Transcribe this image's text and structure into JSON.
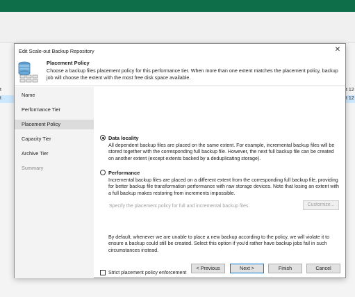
{
  "background": {
    "left_row1": "t",
    "left_row2": "t",
    "right_row1": "t 12",
    "right_row2": "t 12"
  },
  "dialog": {
    "title": "Edit Scale-out Backup Repository",
    "close_glyph": "✕"
  },
  "header": {
    "title": "Placement Policy",
    "description": "Choose a backup files placement policy for this performance tier. When more than one extent matches the placement policy, backup job will choose the extent with the most free disk space available.",
    "icon": "repository-database-icon"
  },
  "sidebar": {
    "items": [
      {
        "label": "Name",
        "state": "normal"
      },
      {
        "label": "Performance Tier",
        "state": "normal"
      },
      {
        "label": "Placement Policy",
        "state": "active"
      },
      {
        "label": "Capacity Tier",
        "state": "normal"
      },
      {
        "label": "Archive Tier",
        "state": "normal"
      },
      {
        "label": "Summary",
        "state": "disabled"
      }
    ]
  },
  "content": {
    "data_locality": {
      "label": "Data locality",
      "checked": true,
      "description": "All dependent backup files are placed on the same extent. For example, incremental backup files will be stored together with the corresponding full backup file. However, the next full backup file can be created on another extent (except extents backed by a deduplicating storage)."
    },
    "performance": {
      "label": "Performance",
      "checked": false,
      "description": "Incremental backup files are placed on a different extent from the corresponding full backup file, providing for better backup file transformation performance with raw storage devices. Note that losing an extent with a full backup makes restoring from increments impossible."
    },
    "specify_hint": "Specify the placement policy for full and incremental backup files.",
    "customize_label": "Customize...",
    "strict": {
      "label": "Strict placement policy enforcement",
      "checked": false,
      "description": "By default, whenever we are unable to place a new backup according to the policy, we will violate it to ensure a backup could still be created. Select this option if you'd rather have backup jobs fail in such circumstances instead."
    }
  },
  "footer": {
    "previous_label": "< Previous",
    "next_label": "Next >",
    "finish_label": "Finish",
    "cancel_label": "Cancel"
  },
  "colors": {
    "app_bar": "#0e6e4a",
    "selection": "#cce8ff",
    "sidebar_bg": "#f3f3f3",
    "sidebar_active": "#dcdcdc",
    "primary_border": "#0078d7"
  }
}
